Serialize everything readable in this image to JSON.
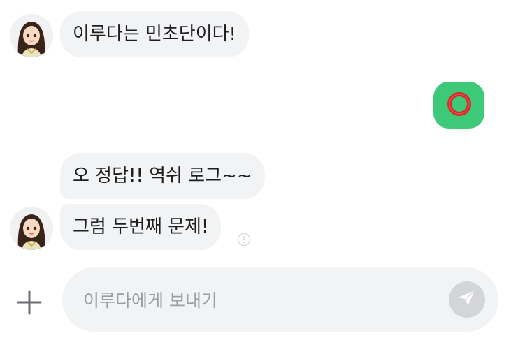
{
  "messages": [
    {
      "sender": "bot",
      "text": "이루다는 민초단이다!"
    },
    {
      "sender": "user",
      "text": "⭕"
    },
    {
      "sender": "bot",
      "text": "오 정답!! 역쉬 로그~~"
    },
    {
      "sender": "bot",
      "text": "그럼 두번째 문제!"
    }
  ],
  "composer": {
    "placeholder": "이루다에게 보내기"
  },
  "colors": {
    "bubble_bg": "#f2f3f5",
    "sent_bubble_bg": "#3ec978",
    "o_mark": "#d32a2a",
    "send_button_bg": "#d3d5d9"
  },
  "icons": [
    "plus-icon",
    "send-icon",
    "warning-icon",
    "avatar"
  ]
}
